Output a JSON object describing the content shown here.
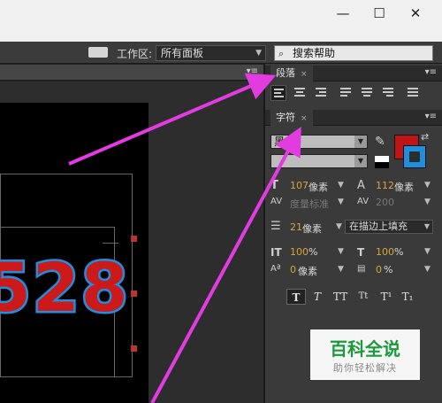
{
  "window": {
    "minimize_glyph": "—",
    "maximize_glyph": "☐",
    "close_glyph": "✕"
  },
  "toolbar": {
    "workspace_label": "工作区:",
    "workspace_value": "所有面板",
    "search_placeholder": "搜索帮助",
    "search_icon": "magnifier-icon",
    "workspace_icon": "workspace-icon"
  },
  "canvas": {
    "text": "528",
    "text_fill": "#cc1a1a",
    "text_stroke": "#1e8fe0"
  },
  "paragraph_panel": {
    "tab_label": "段落",
    "close": "×",
    "menu": "▾≡",
    "align_icons": [
      "align-left-icon",
      "align-center-icon",
      "align-right-icon",
      "justify-left-icon",
      "justify-center-icon",
      "justify-right-icon",
      "justify-all-icon"
    ]
  },
  "character_panel": {
    "tab_label": "字符",
    "close": "×",
    "menu": "▾≡",
    "font_family": "黑体",
    "font_style": "",
    "fill_color": "#c01515",
    "stroke_color": "#1e8fe0",
    "font_size_value": "107",
    "font_size_unit": "像素",
    "leading_value": "112",
    "leading_unit": "像素",
    "kerning_label": "度量标准",
    "tracking_value": "200",
    "stroke_width_value": "21",
    "stroke_width_unit": "像素",
    "stroke_mode": "在描边上填充",
    "vert_scale_value": "100",
    "vert_scale_unit": "%",
    "horiz_scale_value": "100",
    "horiz_scale_unit": "%",
    "baseline_value": "0",
    "baseline_unit": "像素",
    "tsume_value": "0",
    "tsume_unit": "%",
    "style_buttons": [
      "T",
      "T",
      "TT",
      "Tt",
      "T¹",
      "T₁"
    ]
  },
  "watermark": {
    "title": "百科全说",
    "subtitle": "助你轻松解决"
  }
}
